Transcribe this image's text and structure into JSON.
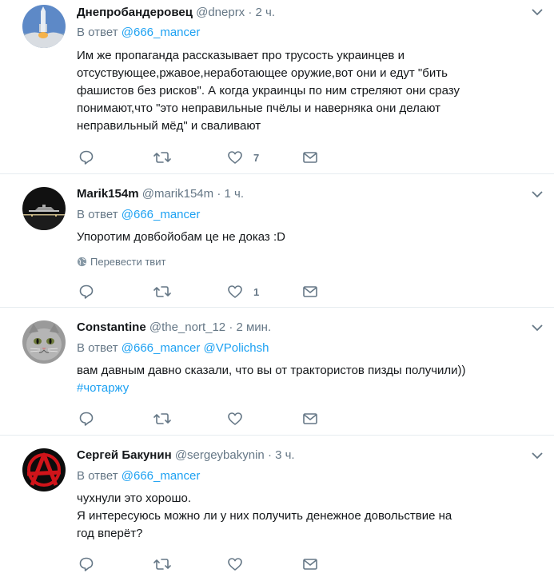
{
  "reply_prefix": "В ответ",
  "tweets": [
    {
      "name": "Днепробандеровец",
      "handle": "@dneprx",
      "dot": "·",
      "time": "2 ч.",
      "reply_to": "@666_mancer",
      "lines": [
        "Им же пропаганда рассказывает про трусость украинцев и",
        "отсуствующее,ржавое,неработающее оружие,вот они и едут \"бить",
        "фашистов без рисков\". А когда украинцы по ним стреляют они сразу",
        "понимают,что \"это неправильные пчёлы и наверняка они делают",
        "неправильный мёд\" и сваливают"
      ],
      "like_count": "7"
    },
    {
      "name": "Marik154m",
      "handle": "@marik154m",
      "dot": "·",
      "time": "1 ч.",
      "reply_to": "@666_mancer",
      "lines": [
        "Упоротим довбойобам це не доказ :D"
      ],
      "translate": "Перевести твит",
      "like_count": "1"
    },
    {
      "name": "Constantine",
      "handle": "@the_nort_12",
      "dot": "·",
      "time": "2 мин.",
      "reply_to": "@666_mancer",
      "reply_to_2": "@VPolichsh",
      "lines": [
        "вам давным давно сказали, что вы от трактористов пизды получили))"
      ],
      "hashtag": "#чотаржу"
    },
    {
      "name": "Сергей Бакунин",
      "handle": "@sergeybakynin",
      "dot": "·",
      "time": "3 ч.",
      "reply_to": "@666_mancer",
      "lines": [
        "чухнули это хорошо.",
        "Я интересуюсь можно ли у них получить денежное довольствие на",
        "год вперёт?"
      ]
    }
  ]
}
